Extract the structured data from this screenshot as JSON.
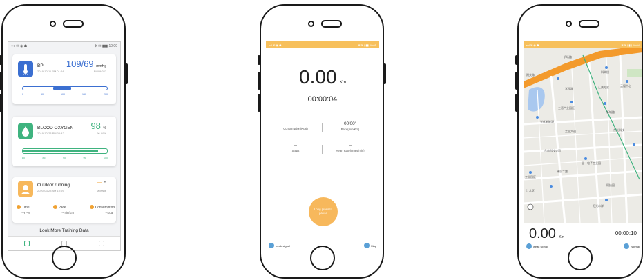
{
  "screen1": {
    "status_left": "▪▪ıl ✉ ◉ ☗",
    "status_right": "✻ ✉ ▮▮▮ 10:09",
    "bp": {
      "title": "BP",
      "value": "109/69",
      "unit": "mmHg",
      "date": "2019-10-11 PM 01:44",
      "note": "BMI 9/287",
      "ticks": [
        "0",
        "50",
        "100",
        "150",
        "200"
      ]
    },
    "oxygen": {
      "title": "BLOOD OXYGEN",
      "value": "98",
      "unit": "%",
      "date": "2019-10-23 PM 05:42",
      "note": "96-99%",
      "ticks": [
        "80",
        "85",
        "90",
        "95",
        "100"
      ]
    },
    "running": {
      "title": "Outdoor running",
      "value": "—",
      "unit": "m",
      "date": "2020-03-23 AM 10:09",
      "note": "Mileage",
      "time_label": "Time",
      "time_value": "--H --M",
      "pace_label": "Pace",
      "pace_value": "--min/Km",
      "cons_label": "Consumption",
      "cons_value": "--Kcal"
    },
    "more_link": "Look More Training Data"
  },
  "screen2": {
    "status_left": "▪▪ıl ✉ ◉ ☗",
    "status_right": "✻ ✉ ▮▮▮ 10:05",
    "distance": "0.00",
    "distance_unit": "Km",
    "timer": "00:00:04",
    "consumption_value": "--",
    "consumption_label": "Consumption(Kcal)",
    "pace_value": "00'00\"",
    "pace_label": "Pace(min/Km)",
    "steps_value": "--",
    "steps_label": "Steps",
    "heart_value": "--",
    "heart_label": "Heart Rate(times/min)",
    "stop_button": "Long press to pause",
    "signal_label": "weak signal",
    "map_label": "Map"
  },
  "screen3": {
    "status_left": "▪▪ıl ✉ ◉ ☗",
    "status_right": "✻ ✉ ▮▮▮ 10:04",
    "distance": "0.00",
    "distance_unit": "Km",
    "timer": "00:00:10",
    "signal_label": "weak signal",
    "mode_label": "Normal",
    "poi": [
      "机场路",
      "阳关路",
      "学院路",
      "科文楼",
      "汇景方家",
      "三晋产业园区",
      "光伏新能源",
      "全一电子工业园",
      "东南科技公司",
      "工业园区",
      "建设二路",
      "新城路",
      "江北区",
      "阳光水岸",
      "科技园",
      "云服中心",
      "东光科技",
      "工业大道"
    ]
  },
  "colors": {
    "accent_blue": "#3b6fd1",
    "accent_green": "#3fb37f",
    "accent_orange": "#f7b85c"
  }
}
